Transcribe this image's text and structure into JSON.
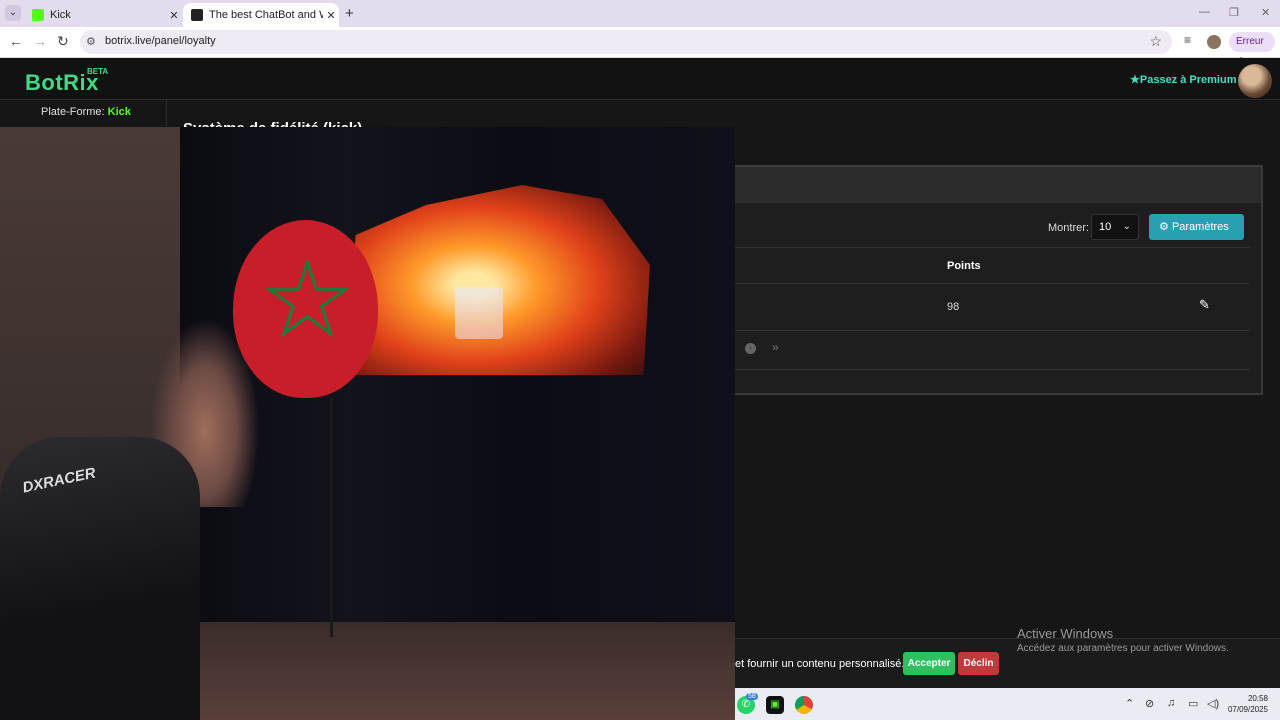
{
  "browser": {
    "tabs": [
      {
        "title": "Kick",
        "favicon_color": "#53fc18",
        "active": false
      },
      {
        "title": "The best ChatBot and Widgets",
        "favicon_color": "#222222",
        "active": true
      }
    ],
    "new_tab_glyph": "+",
    "url": "botrix.live/panel/loyalty",
    "profile_status": "Erreur"
  },
  "site": {
    "logo": "BotRix",
    "logo_badge": "BETA",
    "premium_label": "Passez à Premium",
    "platform_label": "Plate-Forme:",
    "platform_value": "Kick",
    "page_title": "Système de fidélité (kick)"
  },
  "loyalty_table": {
    "show_label": "Montrer:",
    "page_size": "10",
    "settings_button": "Paramètres",
    "columns": [
      "Points"
    ],
    "rows": [
      {
        "points": "98"
      }
    ]
  },
  "cookie_banner": {
    "text": "et fournir un contenu personnalisé.",
    "accept": "Accepter",
    "decline": "Déclin"
  },
  "windows_watermark": {
    "title": "Activer Windows",
    "subtitle": "Accédez aux paramètres pour activer Windows."
  },
  "taskbar": {
    "whatsapp_badge": "58",
    "time": "20:58",
    "date": "07/09/2025"
  },
  "webcam": {
    "chair_brand": "DXRACER"
  },
  "colors": {
    "accent_green": "#3ddc84",
    "kick_green": "#53fc18",
    "button_teal": "#2b9fb2",
    "accept_green": "#2ebf5e",
    "decline_red": "#c0393b"
  }
}
